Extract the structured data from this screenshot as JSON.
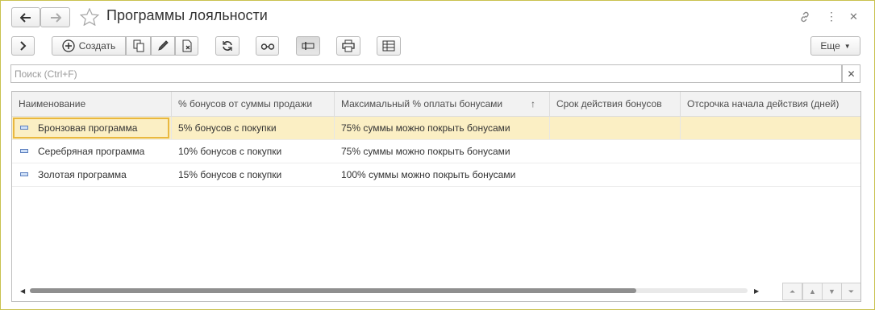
{
  "window": {
    "title": "Программы лояльности"
  },
  "toolbar": {
    "create_label": "Создать",
    "more_label": "Еще"
  },
  "search": {
    "placeholder": "Поиск (Ctrl+F)",
    "value": ""
  },
  "table": {
    "columns": [
      "Наименование",
      "% бонусов от суммы продажи",
      "Максимальный % оплаты бонусами",
      "Срок действия бонусов",
      "Отсрочка начала действия (дней)"
    ],
    "sort_indicator": "↑",
    "rows": [
      [
        "Бронзовая программа",
        "5% бонусов с покупки",
        "75% суммы можно покрыть бонусами",
        "",
        ""
      ],
      [
        "Серебряная программа",
        "10% бонусов с покупки",
        "75% суммы можно покрыть бонусами",
        "",
        ""
      ],
      [
        "Золотая программа",
        "15% бонусов с покупки",
        "100% суммы можно покрыть бонусами",
        "",
        ""
      ]
    ],
    "selected_row": 0
  },
  "colors": {
    "selected_row": "#fbefc4",
    "focus_border": "#e9b83f",
    "window_border": "#c9c24f"
  }
}
